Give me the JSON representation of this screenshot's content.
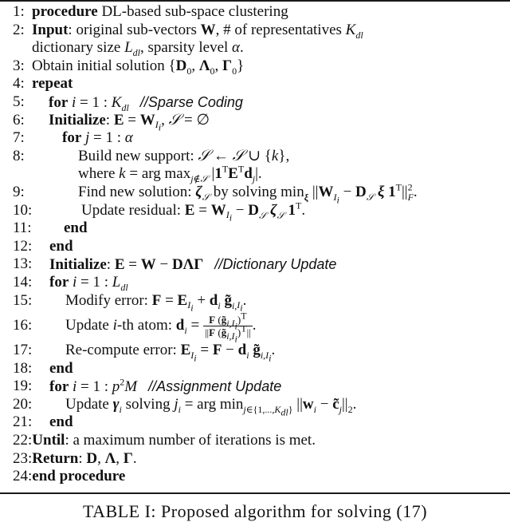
{
  "document": {
    "type": "algorithm-table",
    "caption": "TABLE I: Proposed algorithm for solving (17)",
    "lines": [
      {
        "num": "1:",
        "keyword": "procedure",
        "text": " DL-based sub-space clustering"
      },
      {
        "num": "2:",
        "keyword": "Input",
        "text": ": original sub-vectors W, # of representatives K_dl"
      },
      {
        "num": "",
        "keyword": "",
        "text": "dictionary size L_dl, sparsity level α."
      },
      {
        "num": "3:",
        "keyword": "",
        "text": "Obtain initial solution {D₀, Λ₀, Γ₀}"
      },
      {
        "num": "4:",
        "keyword": "repeat",
        "text": ""
      },
      {
        "num": "5:",
        "keyword": "for",
        "text": " i = 1 : K_dl",
        "comment": "//Sparse Coding"
      },
      {
        "num": "6:",
        "keyword": "Initialize",
        "text": ": E = W_{I_i}, S = ∅"
      },
      {
        "num": "7:",
        "keyword": "for",
        "text": " j = 1 : α"
      },
      {
        "num": "8:",
        "keyword": "",
        "text": "Build new support: S ← S ∪ {k},"
      },
      {
        "num": "",
        "keyword": "",
        "text": "where k = arg max_{j∉S} |1ᵀEᵀd_j|."
      },
      {
        "num": "9:",
        "keyword": "",
        "text": "Find new solution: ζ_S by solving min_ξ ||W_{I_i} − D_S ξ 1ᵀ||²_F."
      },
      {
        "num": "10:",
        "keyword": "",
        "text": "Update residual: E = W_{I_i} − D_S ζ_S 1ᵀ."
      },
      {
        "num": "11:",
        "keyword": "end",
        "text": ""
      },
      {
        "num": "12:",
        "keyword": "end",
        "text": ""
      },
      {
        "num": "13:",
        "keyword": "Initialize",
        "text": ": E = W − DΛΓ",
        "comment": "//Dictionary Update"
      },
      {
        "num": "14:",
        "keyword": "for",
        "text": " i = 1 : L_dl"
      },
      {
        "num": "15:",
        "keyword": "",
        "text": "Modify error: F = E_{I_i} + d_i g̃_{i,I_i}."
      },
      {
        "num": "16:",
        "keyword": "",
        "text": "Update i-th atom: d_i = F (g̃_{i,I_i})ᵀ / ||F (g̃_{i,I_i})ᵀ||."
      },
      {
        "num": "17:",
        "keyword": "",
        "text": "Re-compute error: E_{I_i} = F − d_i g̃_{i,I_i}."
      },
      {
        "num": "18:",
        "keyword": "end",
        "text": ""
      },
      {
        "num": "19:",
        "keyword": "for",
        "text": " i = 1 : p²M",
        "comment": "//Assignment Update"
      },
      {
        "num": "20:",
        "keyword": "",
        "text": "Update γ_i solving j_i = arg min_{j∈{1,...,K_dl}} ||w_i − c̃_j||₂."
      },
      {
        "num": "21:",
        "keyword": "end",
        "text": ""
      },
      {
        "num": "22:",
        "keyword": "Until",
        "text": ": a maximum number of iterations is met."
      },
      {
        "num": "23:",
        "keyword": "Return",
        "text": ": D, Λ, Γ."
      },
      {
        "num": "24:",
        "keyword": "end procedure",
        "text": ""
      }
    ]
  },
  "labels": {
    "n1": "1:",
    "n2": "2:",
    "n3": "3:",
    "n4": "4:",
    "n5": "5:",
    "n6": "6:",
    "n7": "7:",
    "n8": "8:",
    "n9": "9:",
    "n10": "10:",
    "n11": "11:",
    "n12": "12:",
    "n13": "13:",
    "n14": "14:",
    "n15": "15:",
    "n16": "16:",
    "n17": "17:",
    "n18": "18:",
    "n19": "19:",
    "n20": "20:",
    "n21": "21:",
    "n22": "22:",
    "n23": "23:",
    "n24": "24:",
    "kw_procedure": "procedure",
    "kw_input": "Input",
    "kw_repeat": "repeat",
    "kw_for": "for",
    "kw_initialize": "Initialize",
    "kw_end": "end",
    "kw_until": "Until",
    "kw_return": "Return",
    "kw_end_procedure": "end procedure",
    "t1": " DL-based sub-space clustering",
    "t2a": ": original sub-vectors ",
    "t2b": ", # of representatives ",
    "t2c": "dictionary size ",
    "t2d": ", sparsity level ",
    "t2e": ".",
    "t3": "Obtain initial solution ",
    "t8a": "Build new support: ",
    "t8b": "where ",
    "t9a": "Find new solution: ",
    "t9b": " by solving ",
    "t10": "Update residual: ",
    "t15": "Modify error: ",
    "t16": "Update ",
    "t16b": "-th atom: ",
    "t17": "Re-compute error: ",
    "t20a": "Update ",
    "t20b": " solving ",
    "t22": ": a maximum number of iterations is met.",
    "c5": "//Sparse Coding",
    "c13": "//Dictionary Update",
    "c19": "//Assignment Update"
  }
}
